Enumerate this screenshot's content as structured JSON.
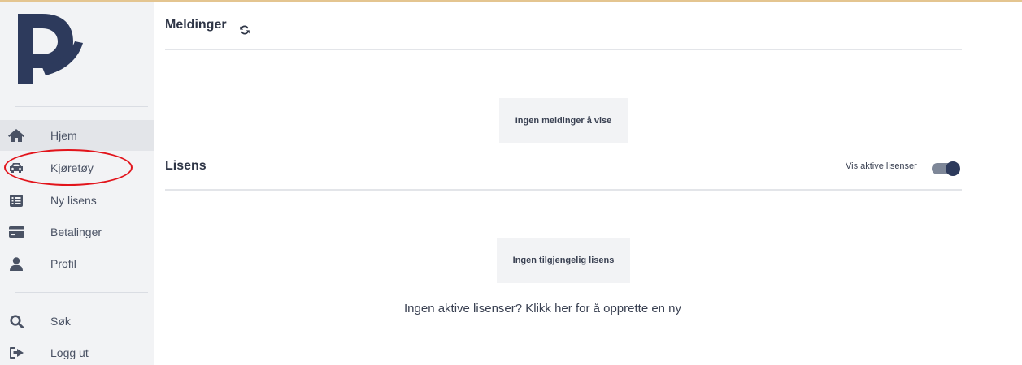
{
  "sidebar": {
    "items": [
      {
        "label": "Hjem",
        "icon": "home-icon",
        "active": true
      },
      {
        "label": "Kjøretøy",
        "icon": "car-icon"
      },
      {
        "label": "Ny lisens",
        "icon": "list-icon"
      },
      {
        "label": "Betalinger",
        "icon": "credit-card-icon"
      },
      {
        "label": "Profil",
        "icon": "user-icon"
      }
    ],
    "bottom_items": [
      {
        "label": "Søk",
        "icon": "search-icon"
      },
      {
        "label": "Logg ut",
        "icon": "logout-icon"
      }
    ]
  },
  "messages": {
    "title": "Meldinger",
    "empty_text": "Ingen meldinger å vise"
  },
  "license": {
    "title": "Lisens",
    "toggle_label": "Vis aktive lisenser",
    "toggle_on": true,
    "empty_text": "Ingen tilgjengelig lisens",
    "cta_text": "Ingen aktive lisenser? Klikk her for å opprette en ny"
  },
  "colors": {
    "brand": "#2d3a5c",
    "highlight": "#e2141b",
    "top_accent": "#e4c590"
  }
}
